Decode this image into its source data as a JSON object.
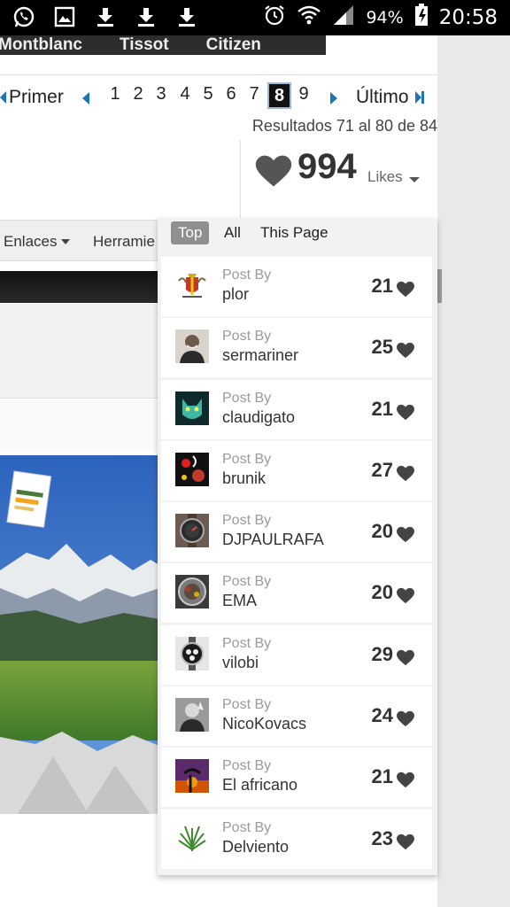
{
  "status_bar": {
    "battery": "94%",
    "time": "20:58",
    "icons": [
      "whatsapp-icon",
      "image-icon",
      "download-icon",
      "download-icon",
      "download-icon",
      "alarm-icon",
      "wifi-icon",
      "signal-icon",
      "battery-icon"
    ]
  },
  "brands": [
    "Montblanc",
    "Tissot",
    "Citizen"
  ],
  "pagination": {
    "first": "Primer",
    "last": "Último",
    "pages": [
      "1",
      "2",
      "3",
      "4",
      "5",
      "6",
      "7",
      "8",
      "9"
    ],
    "current": "8"
  },
  "results": "Resultados 71 al 80 de 84",
  "likes": {
    "count": "994",
    "label": "Likes"
  },
  "nav": {
    "enlaces": "Enlaces",
    "herramientas": "Herramie"
  },
  "dropdown": {
    "tabs": [
      "Top",
      "All",
      "This Page"
    ],
    "active_tab": "Top",
    "post_by_label": "Post By",
    "items": [
      {
        "user": "plor",
        "count": "21"
      },
      {
        "user": "sermariner",
        "count": "25"
      },
      {
        "user": "claudigato",
        "count": "21"
      },
      {
        "user": "brunik",
        "count": "27"
      },
      {
        "user": "DJPAULRAFA",
        "count": "20"
      },
      {
        "user": "EMA",
        "count": "20"
      },
      {
        "user": "vilobi",
        "count": "29"
      },
      {
        "user": "NicoKovacs",
        "count": "24"
      },
      {
        "user": "El africano",
        "count": "21"
      },
      {
        "user": "Delviento",
        "count": "23"
      }
    ]
  },
  "colors": {
    "link_blue": "#1d74b7",
    "heart_gray": "#555555"
  }
}
